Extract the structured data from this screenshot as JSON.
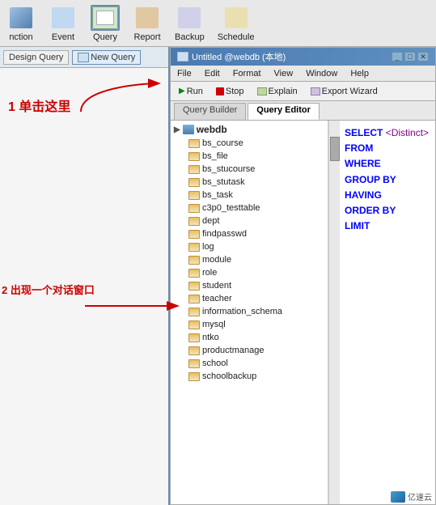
{
  "toolbar": {
    "items": [
      {
        "id": "function",
        "label": "nction"
      },
      {
        "id": "event",
        "label": "Event"
      },
      {
        "id": "query",
        "label": "Query",
        "active": true
      },
      {
        "id": "report",
        "label": "Report"
      },
      {
        "id": "backup",
        "label": "Backup"
      },
      {
        "id": "schedule",
        "label": "Schedule"
      }
    ]
  },
  "left_panel": {
    "design_query_label": "Design Query",
    "new_query_label": "New Query"
  },
  "annotation1": "1 单击这里",
  "annotation2": "2 出现一个对话窗口",
  "window": {
    "title": "Untitled @webdb (本地)",
    "menu": [
      "File",
      "Edit",
      "Format",
      "View",
      "Window",
      "Help"
    ],
    "toolbar_btns": [
      "Run",
      "Stop",
      "Explain",
      "Export Wizard"
    ],
    "tabs": [
      "Query Builder",
      "Query Editor"
    ]
  },
  "tree": {
    "root": "webdb",
    "items": [
      "bs_course",
      "bs_file",
      "bs_stucourse",
      "bs_stutask",
      "bs_task",
      "c3p0_testtable",
      "dept",
      "findpasswd",
      "log",
      "module",
      "role",
      "student",
      "teacher",
      "information_schema",
      "mysql",
      "ntko",
      "productmanage",
      "school",
      "schoolbackup"
    ]
  },
  "sql": {
    "select": "SELECT",
    "distinct": "<Distinct>",
    "from": "FROM",
    "where": "WHERE",
    "group_by": "GROUP BY",
    "having": "HAVING",
    "order_by": "ORDER BY",
    "limit": "LIMIT"
  },
  "brand": "亿速云"
}
